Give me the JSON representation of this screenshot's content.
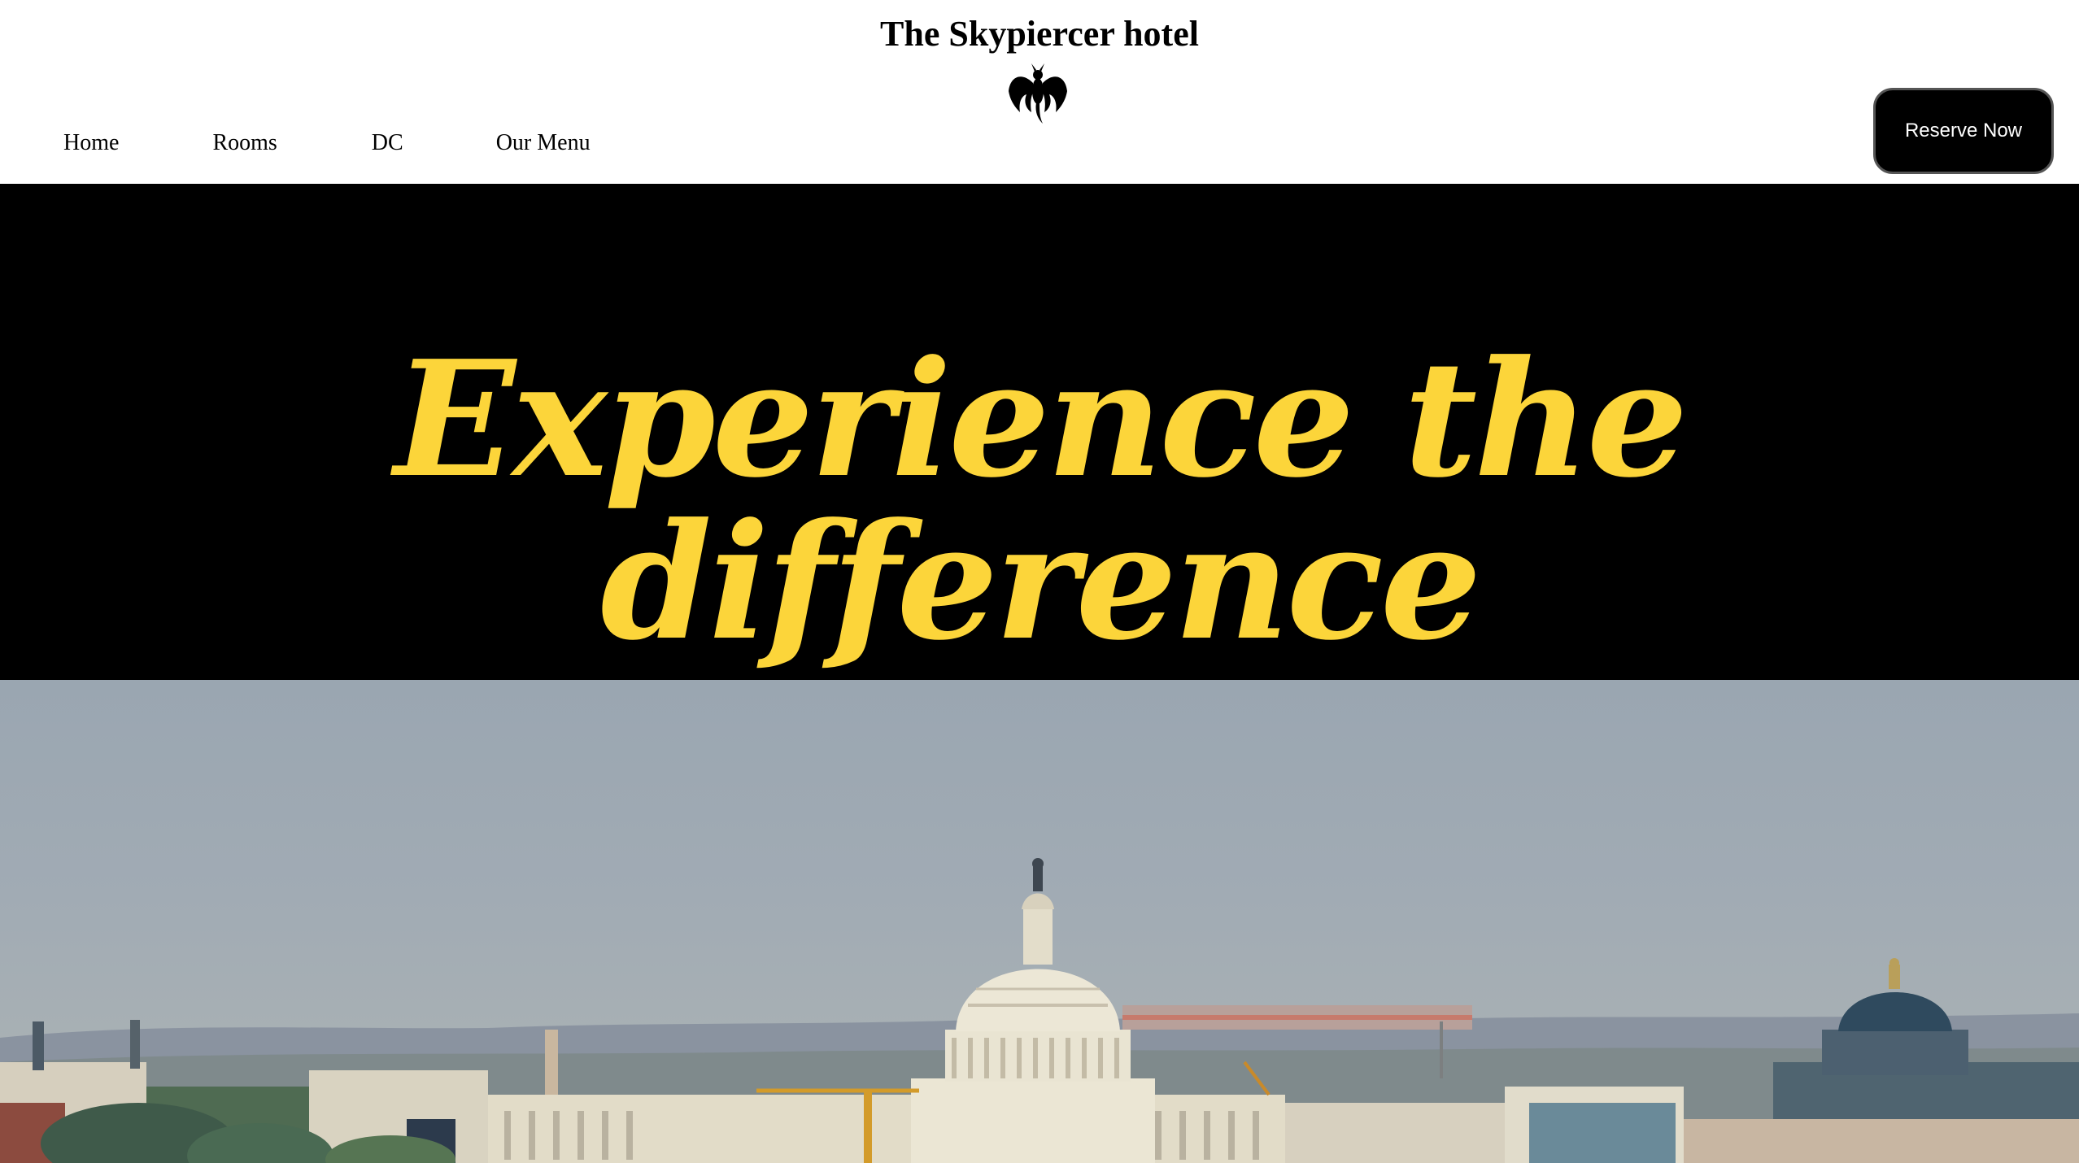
{
  "header": {
    "hotel_name": "The Skypiercer hotel",
    "logo_icon": "winged-creature-icon",
    "nav": [
      {
        "label": "Home"
      },
      {
        "label": "Rooms"
      },
      {
        "label": "DC"
      },
      {
        "label": "Our Menu"
      }
    ],
    "reserve_label": "Reserve Now"
  },
  "hero": {
    "tagline": "Experience the difference",
    "tagline_color": "#fcd53a",
    "band_color": "#000000"
  },
  "photo": {
    "subject": "capitol-skyline-image"
  }
}
